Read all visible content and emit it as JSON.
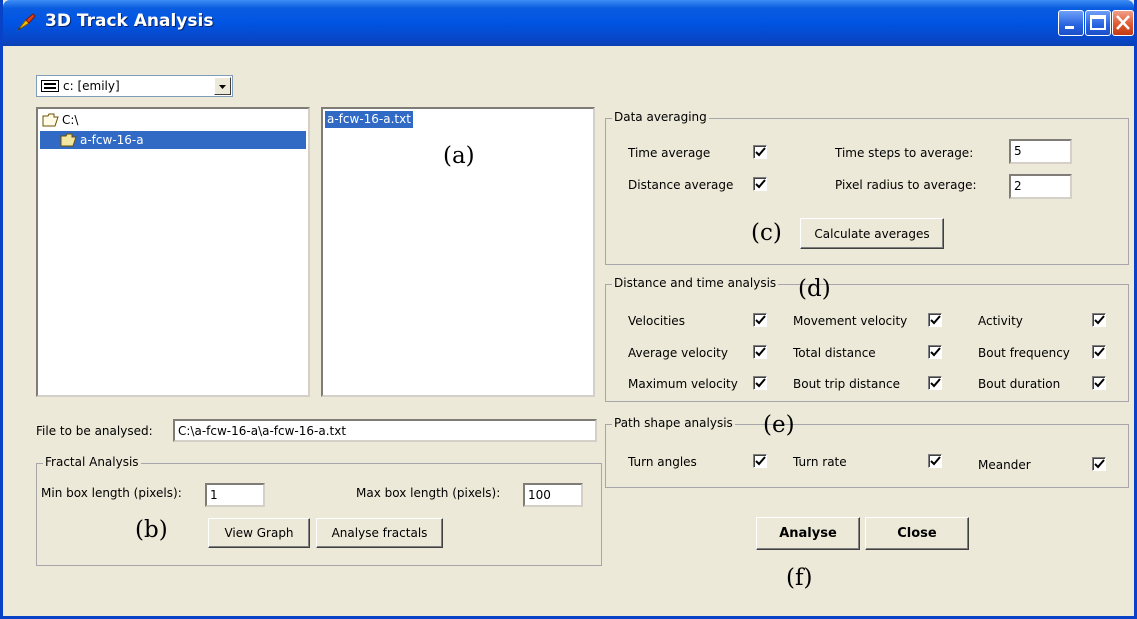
{
  "window": {
    "title": "3D Track Analysis",
    "controls": [
      "minimize",
      "maximize",
      "close"
    ]
  },
  "drive": {
    "label": "c: [emily]",
    "icon": "drive-icon"
  },
  "directories": [
    {
      "label": "C:\\",
      "icon": "open-folder-icon",
      "selected": false
    },
    {
      "label": "a-fcw-16-a",
      "icon": "open-folder-icon",
      "selected": true
    }
  ],
  "files": [
    {
      "label": "a-fcw-16-a.txt",
      "selected": true
    }
  ],
  "annotations": {
    "a": "(a)",
    "b": "(b)",
    "c": "(c)",
    "d": "(d)",
    "e": "(e)",
    "f": "(f)"
  },
  "file_to_analyse": {
    "label": "File to be analysed:",
    "value": "C:\\a-fcw-16-a\\a-fcw-16-a.txt"
  },
  "fractal": {
    "title": "Fractal Analysis",
    "min_label": "Min box length (pixels):",
    "min_value": "1",
    "max_label": "Max box length (pixels):",
    "max_value": "100",
    "view_graph": "View Graph",
    "analyse_fractals": "Analyse fractals"
  },
  "averaging": {
    "title": "Data averaging",
    "time_average": "Time average",
    "time_average_checked": true,
    "distance_average": "Distance average",
    "distance_average_checked": true,
    "time_steps_label": "Time steps to average:",
    "time_steps_value": "5",
    "pixel_radius_label": "Pixel radius to average:",
    "pixel_radius_value": "2",
    "calculate": "Calculate averages"
  },
  "distance_time": {
    "title": "Distance and time analysis",
    "items": [
      {
        "label": "Velocities",
        "checked": true
      },
      {
        "label": "Movement velocity",
        "checked": true
      },
      {
        "label": "Activity",
        "checked": true
      },
      {
        "label": "Average velocity",
        "checked": true
      },
      {
        "label": "Total distance",
        "checked": true
      },
      {
        "label": "Bout frequency",
        "checked": true
      },
      {
        "label": "Maximum velocity",
        "checked": true
      },
      {
        "label": "Bout trip distance",
        "checked": true
      },
      {
        "label": "Bout duration",
        "checked": true
      }
    ]
  },
  "path_shape": {
    "title": "Path shape analysis",
    "items": [
      {
        "label": "Turn angles",
        "checked": true
      },
      {
        "label": "Turn rate",
        "checked": true
      },
      {
        "label": "Meander",
        "checked": true
      }
    ]
  },
  "buttons": {
    "analyse": "Analyse",
    "close": "Close"
  },
  "colors": {
    "titlebar": "#0054e3",
    "selection": "#316ac5",
    "face": "#ece9d8"
  }
}
